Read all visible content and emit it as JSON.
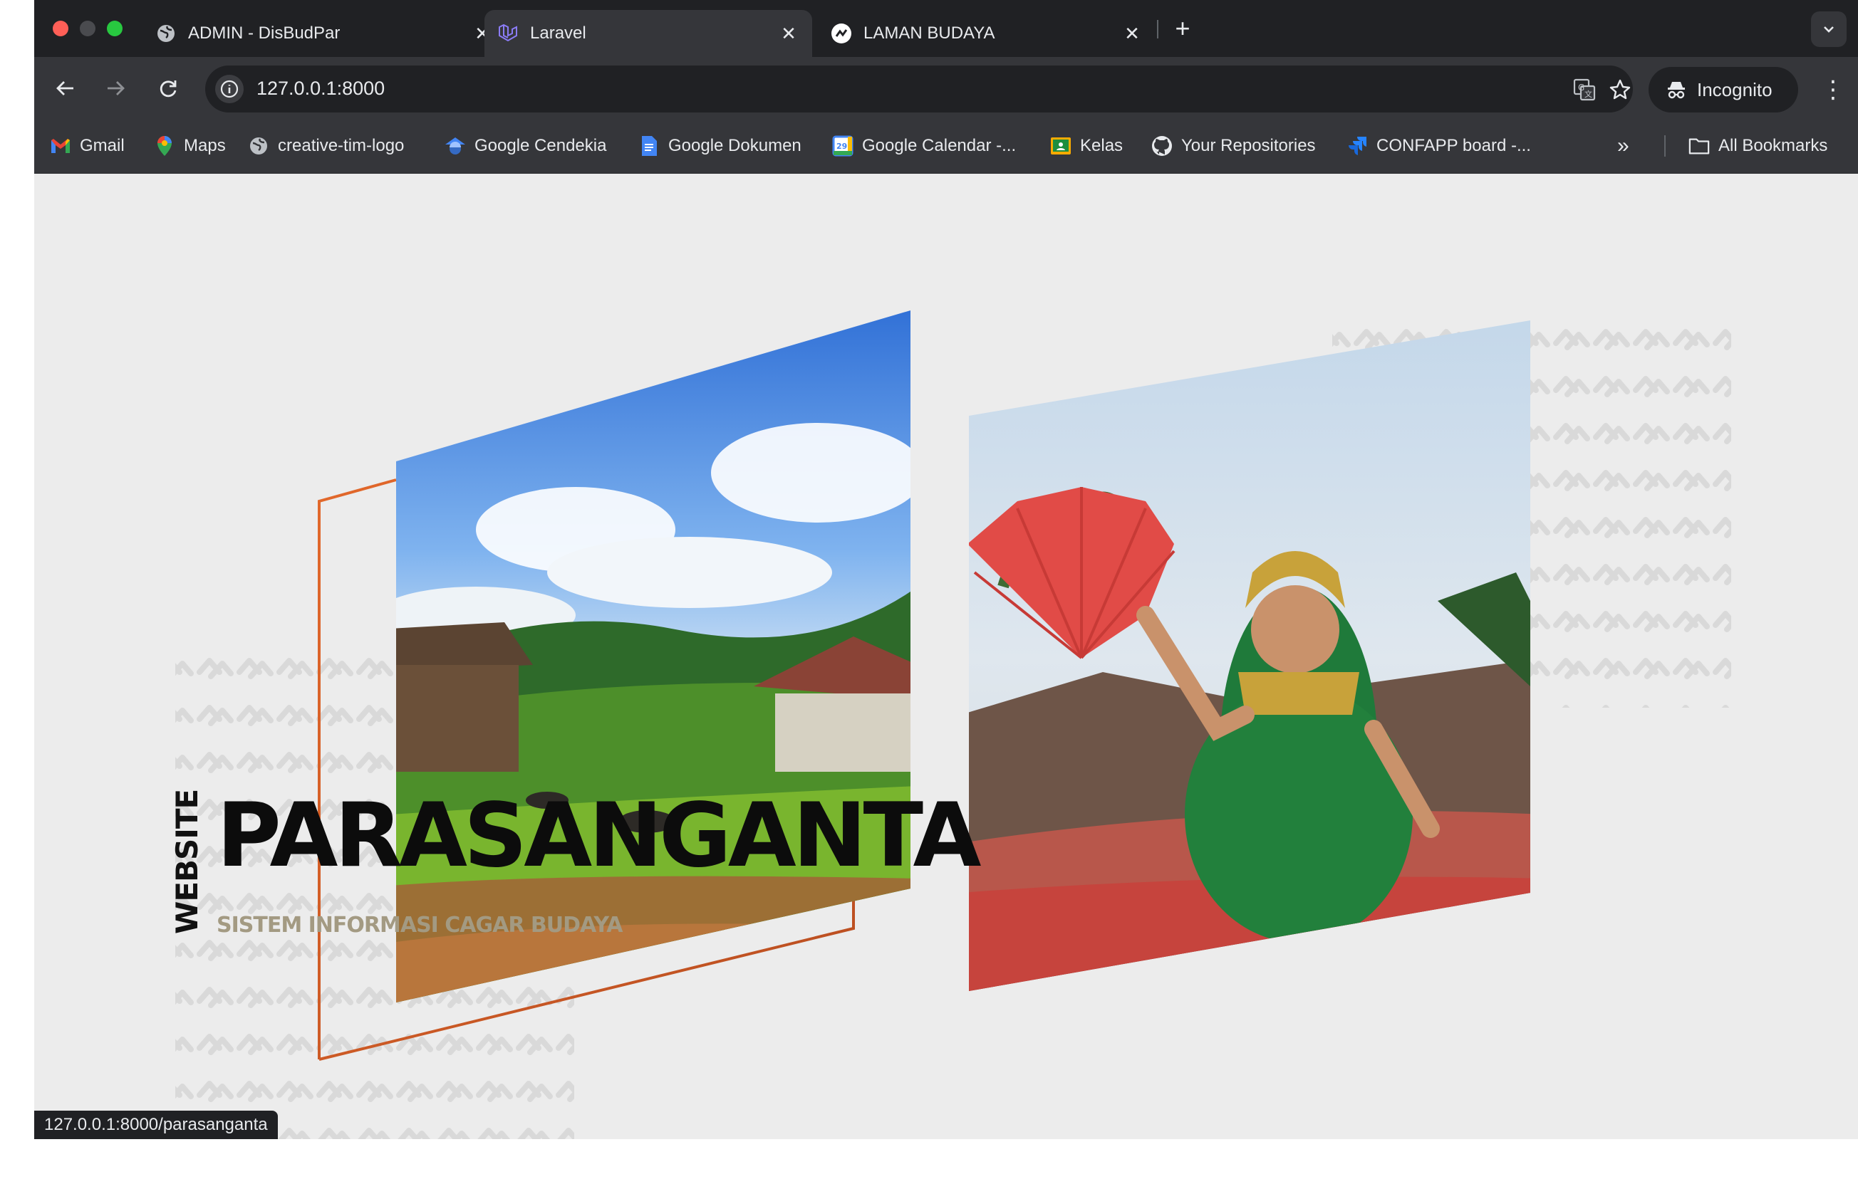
{
  "browser": {
    "tabs": [
      {
        "title": "ADMIN - DisBudPar",
        "icon": "globe-icon",
        "active": false
      },
      {
        "title": "Laravel",
        "icon": "laravel-icon",
        "active": true
      },
      {
        "title": "LAMAN BUDAYA",
        "icon": "site-icon",
        "active": false
      }
    ],
    "address": "127.0.0.1:8000",
    "incognito_label": "Incognito",
    "bookmarks": [
      {
        "label": "Gmail",
        "icon": "gmail-icon"
      },
      {
        "label": "Maps",
        "icon": "maps-pin-icon"
      },
      {
        "label": "creative-tim-logo",
        "icon": "globe-icon"
      },
      {
        "label": "Google Cendekia",
        "icon": "scholar-icon"
      },
      {
        "label": "Google Dokumen",
        "icon": "docs-icon"
      },
      {
        "label": "Google Calendar -...",
        "icon": "calendar-icon"
      },
      {
        "label": "Kelas",
        "icon": "classroom-icon"
      },
      {
        "label": "Your Repositories",
        "icon": "github-icon"
      },
      {
        "label": "CONFAPP board -...",
        "icon": "jira-icon"
      }
    ],
    "all_bookmarks_label": "All Bookmarks",
    "status_url": "127.0.0.1:8000/parasanganta"
  },
  "hero": {
    "vertical_label": "WEBSITE",
    "title": "PARASANGANTA",
    "subtitle": "SISTEM INFORMASI CAGAR BUDAYA",
    "left_image": "village-landscape-photo",
    "right_image": "traditional-fan-dancer-photo",
    "accent_color": "#e2682b"
  }
}
